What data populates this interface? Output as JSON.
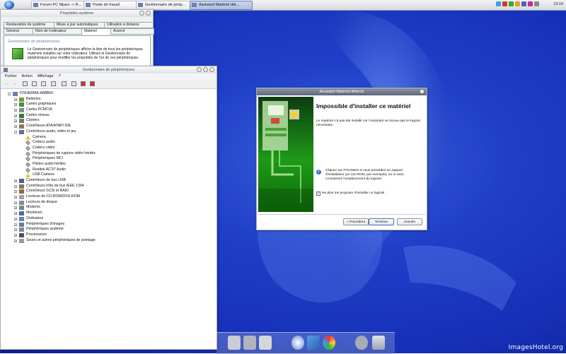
{
  "taskbar": {
    "tasks": [
      {
        "label": "Forum PC Mpact -> R..."
      },
      {
        "label": "Poste de travail"
      },
      {
        "label": "Gestionnaire de périp..."
      },
      {
        "label": "Assistant Matériel dét..."
      }
    ],
    "clock": "13:10"
  },
  "sysprop": {
    "title": "Propriétés système",
    "tabs_row1": [
      "Restauration du système",
      "Mises à jour automatiques",
      "Utilisation à distance"
    ],
    "tabs_row2": [
      "Général",
      "Nom de l'ordinateur",
      "Matériel",
      "Avancé"
    ],
    "group_title": "Gestionnaire de périphériques",
    "description": "Le Gestionnaire de périphériques affiche la liste de tous les périphériques matériels installés sur votre ordinateur. Utilisez le Gestionnaire de périphériques pour modifier les propriétés de l'un de ces périphériques."
  },
  "devmgr": {
    "title": "Gestionnaire de périphériques",
    "menu": [
      "Fichier",
      "Action",
      "Affichage",
      "?"
    ],
    "tree": [
      {
        "label": "FISHERMA-A88B60",
        "level": 0,
        "exp": "-",
        "icon": "computer-icon"
      },
      {
        "label": "Batteries",
        "level": 1,
        "exp": "+",
        "icon": "battery-icon"
      },
      {
        "label": "Cartes graphiques",
        "level": 1,
        "exp": "+",
        "icon": "display-adapter-icon"
      },
      {
        "label": "Cartes PCMCIA",
        "level": 1,
        "exp": "+",
        "icon": "pcmcia-icon"
      },
      {
        "label": "Cartes réseau",
        "level": 1,
        "exp": "+",
        "icon": "network-icon"
      },
      {
        "label": "Claviers",
        "level": 1,
        "exp": "+",
        "icon": "keyboard-icon"
      },
      {
        "label": "Contrôleurs ATA/ATAPI IDE",
        "level": 1,
        "exp": "+",
        "icon": "ide-icon"
      },
      {
        "label": "Contrôleurs audio, vidéo et jeu",
        "level": 1,
        "exp": "-",
        "icon": "audio-icon"
      },
      {
        "label": "Camera",
        "level": 2,
        "exp": "",
        "icon": "warning-icon"
      },
      {
        "label": "Codecs audio",
        "level": 2,
        "exp": "",
        "icon": "codec-icon"
      },
      {
        "label": "Codecs vidéo",
        "level": 2,
        "exp": "",
        "icon": "codec-icon"
      },
      {
        "label": "Périphériques de capture vidéo hérités",
        "level": 2,
        "exp": "",
        "icon": "codec-icon"
      },
      {
        "label": "Périphériques MCI",
        "level": 2,
        "exp": "",
        "icon": "codec-icon"
      },
      {
        "label": "Pilotes audio hérités",
        "level": 2,
        "exp": "",
        "icon": "codec-icon"
      },
      {
        "label": "Realtek AC'97 Audio",
        "level": 2,
        "exp": "",
        "icon": "codec-icon"
      },
      {
        "label": "USB Camera",
        "level": 2,
        "exp": "",
        "icon": "warning-icon"
      },
      {
        "label": "Contrôleurs de bus USB",
        "level": 1,
        "exp": "+",
        "icon": "usb-icon"
      },
      {
        "label": "Contrôleurs hôte de bus IEEE 1394",
        "level": 1,
        "exp": "+",
        "icon": "firewire-icon"
      },
      {
        "label": "Contrôleurs SCSI et RAID",
        "level": 1,
        "exp": "+",
        "icon": "scsi-icon"
      },
      {
        "label": "Lecteurs de CD-ROM/DVD-ROM",
        "level": 1,
        "exp": "+",
        "icon": "cdrom-icon"
      },
      {
        "label": "Lecteurs de disque",
        "level": 1,
        "exp": "+",
        "icon": "disk-icon"
      },
      {
        "label": "Modems",
        "level": 1,
        "exp": "+",
        "icon": "modem-icon"
      },
      {
        "label": "Moniteurs",
        "level": 1,
        "exp": "+",
        "icon": "monitor-icon"
      },
      {
        "label": "Ordinateur",
        "level": 1,
        "exp": "+",
        "icon": "computer-icon"
      },
      {
        "label": "Périphériques d'images",
        "level": 1,
        "exp": "+",
        "icon": "imaging-icon"
      },
      {
        "label": "Périphériques système",
        "level": 1,
        "exp": "+",
        "icon": "system-icon"
      },
      {
        "label": "Processeurs",
        "level": 1,
        "exp": "+",
        "icon": "cpu-icon"
      },
      {
        "label": "Souris et autres périphériques de pointage",
        "level": 1,
        "exp": "+",
        "icon": "mouse-icon"
      }
    ]
  },
  "wizard": {
    "title": "Assistant Matériel détecté",
    "heading": "Impossible d'installer ce matériel",
    "message": "Le matériel n'a pas été installé car l'Assistant ne trouve pas le logiciel nécessaire.",
    "info": "Cliquez sur Précédent si vous possédez un support d'installation (un CD-ROM, par exemple), ou si vous connaissez l'emplacement du logiciel.",
    "checkbox_label": "Ne plus me proposer d'installer ce logiciel",
    "checkbox_checked": true,
    "buttons": {
      "back": "< Précédent",
      "finish": "Terminer",
      "cancel": "Annuler"
    }
  },
  "watermark": "ImagesHotel.org",
  "colors": {
    "desktop": "#1f3fc9",
    "wizard_art": "#1e9a18"
  }
}
